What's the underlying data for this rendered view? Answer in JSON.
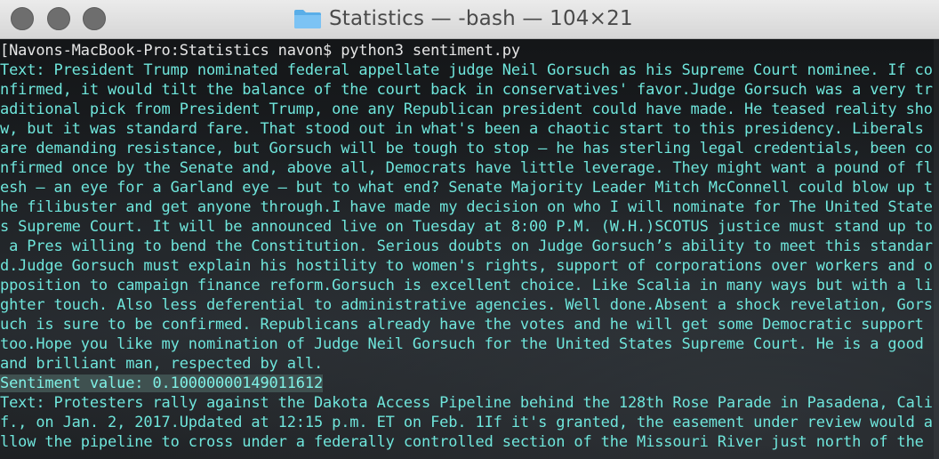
{
  "window": {
    "title": "Statistics — -bash — 104×21",
    "folder_icon": "folder-icon",
    "accent_text_color": "#6fe6dc"
  },
  "terminal": {
    "lines": [
      "[Navons-MacBook-Pro:Statistics navon$ python3 sentiment.py",
      "Text: President Trump nominated federal appellate judge Neil Gorsuch as his Supreme Court nominee. If co",
      "nfirmed, it would tilt the balance of the court back in conservatives' favor.Judge Gorsuch was a very tr",
      "aditional pick from President Trump, one any Republican president could have made. He teased reality sho",
      "w, but it was standard fare. That stood out in what's been a chaotic start to this presidency. Liberals",
      "are demanding resistance, but Gorsuch will be tough to stop – he has sterling legal credentials, been co",
      "nfirmed once by the Senate and, above all, Democrats have little leverage. They might want a pound of fl",
      "esh – an eye for a Garland eye – but to what end? Senate Majority Leader Mitch McConnell could blow up t",
      "he filibuster and get anyone through.I have made my decision on who I will nominate for The United State",
      "s Supreme Court. It will be announced live on Tuesday at 8:00 P.M. (W.H.)SCOTUS justice must stand up to",
      " a Pres willing to bend the Constitution. Serious doubts on Judge Gorsuch’s ability to meet this standar",
      "d.Judge Gorsuch must explain his hostility to women's rights, support of corporations over workers and o",
      "pposition to campaign finance reform.Gorsuch is excellent choice. Like Scalia in many ways but with a li",
      "ghter touch. Also less deferential to administrative agencies. Well done.Absent a shock revelation, Gors",
      "uch is sure to be confirmed. Republicans already have the votes and he will get some Democratic support",
      "too.Hope you like my nomination of Judge Neil Gorsuch for the United States Supreme Court. He is a good",
      "and brilliant man, respected by all.",
      "Sentiment value: 0.10000000149011612",
      "Text: Protesters rally against the Dakota Access Pipeline behind the 128th Rose Parade in Pasadena, Cali",
      "f., on Jan. 2, 2017.Updated at 12:15 p.m. ET on Feb. 1If it's granted, the easement under review would a",
      "llow the pipeline to cross under a federally controlled section of the Missouri River just north of the"
    ]
  }
}
